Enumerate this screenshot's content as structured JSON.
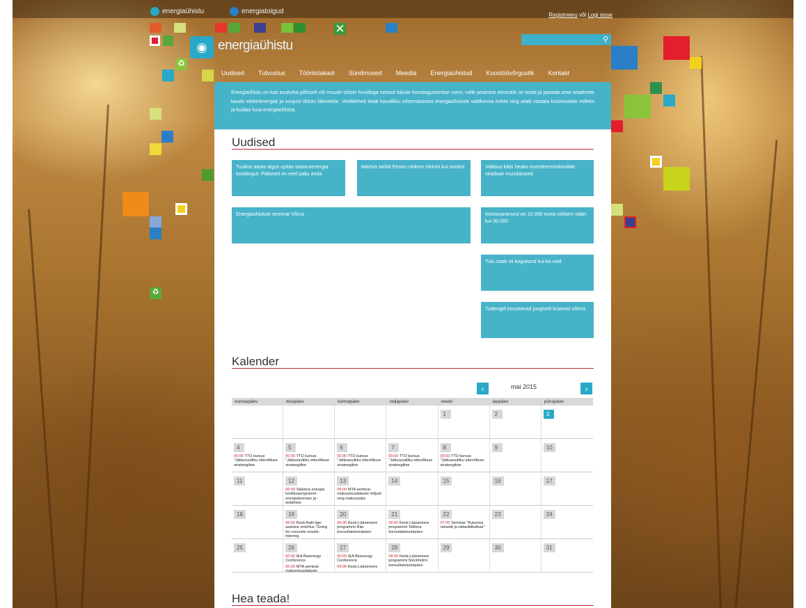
{
  "topbar": {
    "site1": "energiaühistu",
    "site2": "energiatoigud",
    "register": "Registreeru",
    "or": "või",
    "login": "Logi sisse"
  },
  "logo": {
    "text": "energiaühistu"
  },
  "search": {
    "placeholder": ""
  },
  "nav": [
    "Uudised",
    "Tutvustus",
    "Tööriistakast",
    "Sündmused",
    "Meedia",
    "Energiaühistud",
    "Koostöövõrgustik",
    "Kontakt"
  ],
  "intro": "Energiaühistu on kas asukoha põhiselt või muude ühiste huvidega seotud isikute koostegutsemise vorm, mille peamine eesmärk on toota ja jaotada oma seadmete kaudu elektrienergiat ja soojust ühistu liikmetele. Veebilehelt leiab kasulikku informatsiooni energiaühistute valdkonna kohta ning aitab vastata küsimustele milleks ja kuidas luua energiaühistut.",
  "news": {
    "title": "Uudised",
    "items": [
      "Tuuline aasta algus upitas taastuvenergia toodangut. Päikesel on veel palju anda",
      "Märtsis tarbiti Eestis rohkem elektrit kui toodeti",
      "Valitsus kiitis heaks investeerimisfondide seaduse muudatused",
      "Energiaühistute seminar Võrus",
      "Kinnisvarатurul on 10 000 eurot rohkem väärt kui 30 000",
      "Tulu saab nii kogukond kui ka vald",
      "Tudengid innustavad joogivett kraanist võtma"
    ]
  },
  "calendar": {
    "title": "Kalender",
    "month": "mai 2015",
    "days": [
      "esmaspäev",
      "teisipäev",
      "kolmapäev",
      "neljapäev",
      "reede",
      "laupäev",
      "pühapäev"
    ],
    "weeks": [
      [
        {
          "d": ""
        },
        {
          "d": ""
        },
        {
          "d": ""
        },
        {
          "d": ""
        },
        {
          "d": "1"
        },
        {
          "d": "2"
        },
        {
          "d": "3",
          "today": true
        }
      ],
      [
        {
          "d": "4",
          "t": "00:00",
          "e": "TTÜ kursus \"Jätkusuutliku ettevõtluse strateegiline"
        },
        {
          "d": "5",
          "t": "00:00",
          "e": "TTÜ kursus \"Jätkusuutliku ettevõtluse strateegiline"
        },
        {
          "d": "6",
          "t": "00:00",
          "e": "TTÜ kursus \"Jätkusuutliku ettevõtluse strateegiline"
        },
        {
          "d": "7",
          "t": "00:00",
          "e": "TTÜ kursus \"Jätkusuutliku ettevõtluse strateegiline"
        },
        {
          "d": "8",
          "t": "00:00",
          "e": "TTÜ kursus \"Jätkusuutliku ettevõtluse strateegiline"
        },
        {
          "d": "9"
        },
        {
          "d": "10"
        }
      ],
      [
        {
          "d": "11"
        },
        {
          "d": "12",
          "t": "06:00",
          "e": "Säästva energia koolitusprogramm - energialoomise ja -tarbimise"
        },
        {
          "d": "13",
          "t": "06:00",
          "e": "MTA seminar maksumuudatuste mõjust ning maksuvaba"
        },
        {
          "d": "14"
        },
        {
          "d": "15"
        },
        {
          "d": "16"
        },
        {
          "d": "17"
        }
      ],
      [
        {
          "d": "18"
        },
        {
          "d": "19",
          "t": "06:00",
          "e": "Kesk-Balti ilge-aastane eriürītus \"Going for concrete results: Interreg"
        },
        {
          "d": "20",
          "t": "06:00",
          "e": "Kesk-Läänemere programmi Riia konsultatsioonipäev"
        },
        {
          "d": "21",
          "t": "06:00",
          "e": "Kesk-Läänemere programmi Tallinna konsultatsioonipäev"
        },
        {
          "d": "22",
          "t": "07:00",
          "e": "Seminar \"Kuluvma rahastit ja rattaolidkultuur\""
        },
        {
          "d": "23"
        },
        {
          "d": "24"
        }
      ],
      [
        {
          "d": "25"
        },
        {
          "d": "26",
          "t": "00:00",
          "e": "IEA Bioenergy Conference",
          "t2": "06:00",
          "e2": "MTA seminar maksumuudatuste"
        },
        {
          "d": "27",
          "t": "00:00",
          "e": "IEA Bioenergy Conference",
          "t2": "06:00",
          "e2": "Kesk-Läänemere"
        },
        {
          "d": "28",
          "t": "06:00",
          "e": "Kesk-Läänemere programmi Stockholmi konsultatsioonipäev"
        },
        {
          "d": "29"
        },
        {
          "d": "30"
        },
        {
          "d": "31"
        }
      ]
    ]
  },
  "hea_teada": {
    "title": "Hea teada!"
  },
  "colors": {
    "accent": "#47b3c9",
    "rule": "#c1272d"
  }
}
